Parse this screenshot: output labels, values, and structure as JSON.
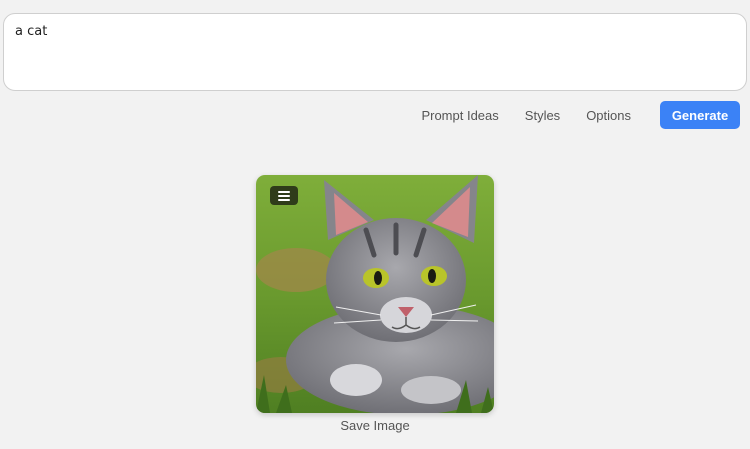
{
  "prompt": {
    "value": "a cat"
  },
  "toolbar": {
    "prompt_ideas_label": "Prompt Ideas",
    "styles_label": "Styles",
    "options_label": "Options",
    "generate_label": "Generate"
  },
  "result": {
    "image_subject": "cat",
    "menu_icon": "hamburger-menu-icon",
    "save_label": "Save Image"
  },
  "colors": {
    "accent": "#3b82f6",
    "background": "#f2f2f2"
  }
}
